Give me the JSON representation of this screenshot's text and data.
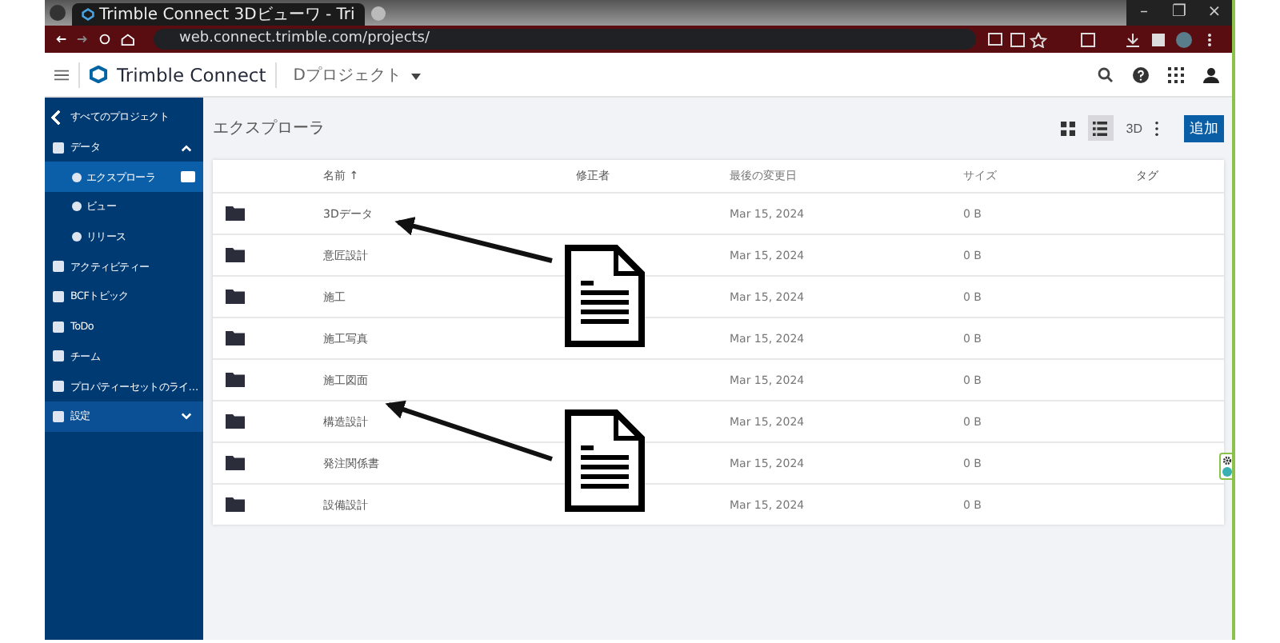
{
  "browser": {
    "tab_title": "Trimble Connect 3Dビューワ - Tri",
    "url": "web.connect.trimble.com/projects/",
    "window_controls": [
      "–",
      "❐",
      "×"
    ]
  },
  "header": {
    "brand": "Trimble Connect",
    "project": "Dプロジェクト"
  },
  "sidebar": {
    "items": [
      {
        "kind": "back",
        "label": "すべてのプロジェクト",
        "selected": false
      },
      {
        "kind": "group",
        "label": "データ",
        "selected": false,
        "expanded": true
      },
      {
        "kind": "sub",
        "label": "エクスプローラ",
        "selected": true
      },
      {
        "kind": "sub",
        "label": "ビュー",
        "selected": false
      },
      {
        "kind": "sub",
        "label": "リリース",
        "selected": false
      },
      {
        "kind": "item",
        "label": "アクティビティー",
        "selected": false
      },
      {
        "kind": "item",
        "label": "BCFトピック",
        "selected": false
      },
      {
        "kind": "item",
        "label": "ToDo",
        "selected": false
      },
      {
        "kind": "item",
        "label": "チーム",
        "selected": false
      },
      {
        "kind": "item",
        "label": "プロパティーセットのライ…",
        "selected": false
      },
      {
        "kind": "group",
        "label": "設定",
        "selected": false,
        "expanded": false,
        "highlighted": true
      }
    ]
  },
  "page": {
    "title": "エクスプローラ",
    "view_3d": "3D",
    "add_button": "追加"
  },
  "table": {
    "columns": [
      "名前 ↑",
      "修正者",
      "最後の変更日",
      "サイズ",
      "タグ"
    ],
    "rows": [
      {
        "name": "3Dデータ",
        "modified": "Mar 15, 2024",
        "size": "0 B"
      },
      {
        "name": "意匠設計",
        "modified": "Mar 15, 2024",
        "size": "0 B"
      },
      {
        "name": "施工",
        "modified": "Mar 15, 2024",
        "size": "0 B"
      },
      {
        "name": "施工写真",
        "modified": "Mar 15, 2024",
        "size": "0 B"
      },
      {
        "name": "施工図面",
        "modified": "Mar 15, 2024",
        "size": "0 B"
      },
      {
        "name": "構造設計",
        "modified": "Mar 15, 2024",
        "size": "0 B"
      },
      {
        "name": "発注関係書",
        "modified": "Mar 15, 2024",
        "size": "0 B"
      },
      {
        "name": "設備設計",
        "modified": "Mar 15, 2024",
        "size": "0 B"
      }
    ]
  }
}
